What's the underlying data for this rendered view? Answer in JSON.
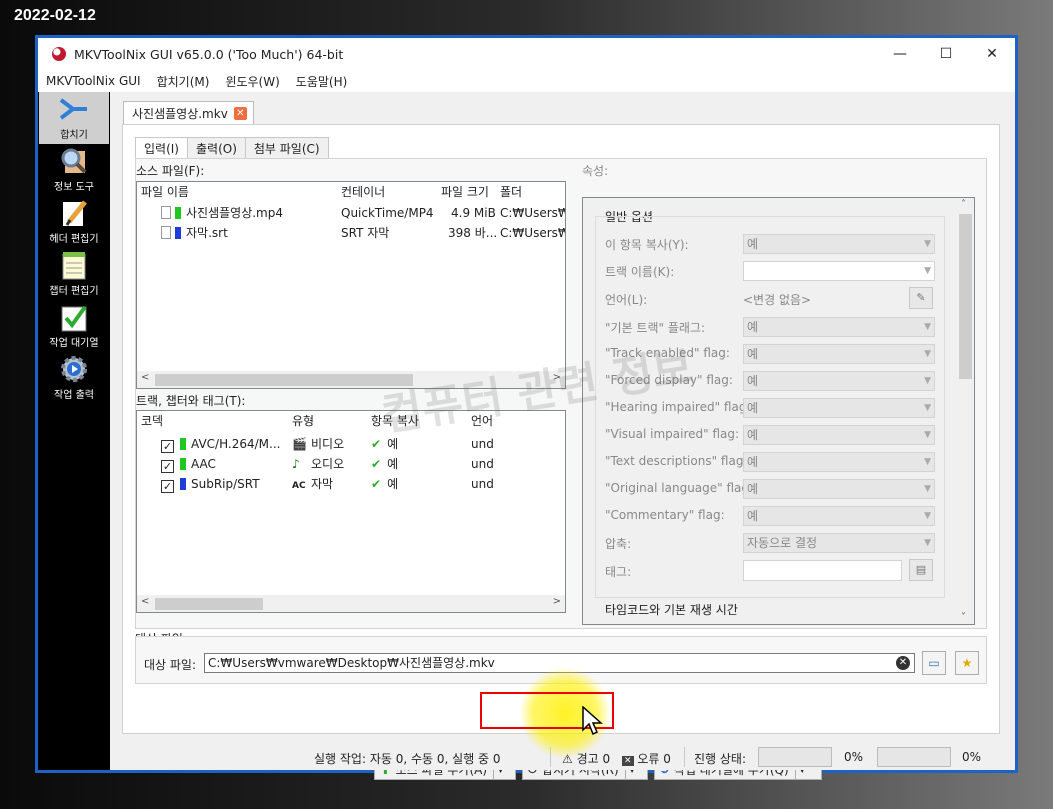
{
  "date_stamp": "2022-02-12",
  "window": {
    "title": "MKVToolNix GUI v65.0.0 ('Too Much') 64-bit",
    "minimize": "—",
    "maximize": "☐",
    "close": "✕"
  },
  "menu": [
    "MKVToolNix GUI",
    "합치기(M)",
    "윈도우(W)",
    "도움말(H)"
  ],
  "sidebar": [
    {
      "label": "합치기",
      "icon": "merge-icon",
      "active": true
    },
    {
      "label": "정보 도구",
      "icon": "magnifier-icon"
    },
    {
      "label": "헤더 편집기",
      "icon": "pencil-icon"
    },
    {
      "label": "챕터 편집기",
      "icon": "notepad-icon"
    },
    {
      "label": "작업 대기열",
      "icon": "checklist-icon"
    },
    {
      "label": "작업 출력",
      "icon": "gear-icon"
    }
  ],
  "file_tab": {
    "label": "사진샘플영상.mkv",
    "close": "✕"
  },
  "inner_tabs": [
    "입력(I)",
    "출력(O)",
    "첨부 파일(C)"
  ],
  "source_files": {
    "label": "소스 파일(F):",
    "columns": [
      "파일 이름",
      "컨테이너",
      "파일 크기",
      "폴더"
    ],
    "rows": [
      {
        "name": "사진샘플영상.mp4",
        "color": "#1ec81e",
        "container": "QuickTime/MP4",
        "size": "4.9 MiB",
        "folder": "C:₩Users₩v"
      },
      {
        "name": "자막.srt",
        "color": "#1f3ddb",
        "container": "SRT 자막",
        "size": "398 바...",
        "folder": "C:₩Users₩v"
      }
    ]
  },
  "tracks": {
    "label": "트랙, 챕터와 태그(T):",
    "columns": [
      "코덱",
      "유형",
      "항목 복사",
      "언어"
    ],
    "rows": [
      {
        "codec": "AVC/H.264/M...",
        "color": "#1ec81e",
        "type": "비디오",
        "type_icon": "film-icon",
        "copy": "예",
        "lang": "und"
      },
      {
        "codec": "AAC",
        "color": "#1ec81e",
        "type": "오디오",
        "type_icon": "music-note-icon",
        "copy": "예",
        "lang": "und"
      },
      {
        "codec": "SubRip/SRT",
        "color": "#1f3ddb",
        "type": "자막",
        "type_icon": "subtitle-icon",
        "copy": "예",
        "lang": "und"
      }
    ]
  },
  "properties": {
    "label": "속성:",
    "group_title": "일반 옵션",
    "fields": [
      {
        "label": "이 항목 복사(Y):",
        "value": "예",
        "kind": "combo"
      },
      {
        "label": "트랙 이름(K):",
        "value": "",
        "kind": "edit-combo"
      },
      {
        "label": "언어(L):",
        "value": "<변경 없음>",
        "kind": "text-button"
      },
      {
        "label": "\"기본 트랙\" 플래그:",
        "value": "예",
        "kind": "combo"
      },
      {
        "label": "\"Track enabled\" flag:",
        "value": "예",
        "kind": "combo"
      },
      {
        "label": "\"Forced display\" flag:",
        "value": "예",
        "kind": "combo"
      },
      {
        "label": "\"Hearing impaired\" flag:",
        "value": "예",
        "kind": "combo"
      },
      {
        "label": "\"Visual impaired\" flag:",
        "value": "예",
        "kind": "combo"
      },
      {
        "label": "\"Text descriptions\" flag:",
        "value": "예",
        "kind": "combo"
      },
      {
        "label": "\"Original language\" flag:",
        "value": "예",
        "kind": "combo"
      },
      {
        "label": "\"Commentary\" flag:",
        "value": "예",
        "kind": "combo"
      },
      {
        "label": "압축:",
        "value": "자동으로 결정",
        "kind": "combo"
      },
      {
        "label": "태그:",
        "value": "",
        "kind": "input-button"
      }
    ],
    "group2_title": "타임코드와 기본 재생 시간"
  },
  "target": {
    "group_label": "대상 파일",
    "label": "대상 파일:",
    "path": "C:₩Users₩vmware₩Desktop₩사진샘플영상.mkv"
  },
  "buttons": {
    "add_source": "소스 파일 추가(A)",
    "start_merge": "합치기 시작(R)",
    "add_queue": "작업 대기열에 추가(Q)"
  },
  "status": {
    "jobs": "실행 작업: 자동 0, 수동 0, 실행 중 0",
    "warnings": "경고 0",
    "errors": "오류 0",
    "progress_label": "진행 상태:",
    "progress1": "0%",
    "progress2": "0%"
  },
  "watermark": "컴퓨터 관련 정보"
}
